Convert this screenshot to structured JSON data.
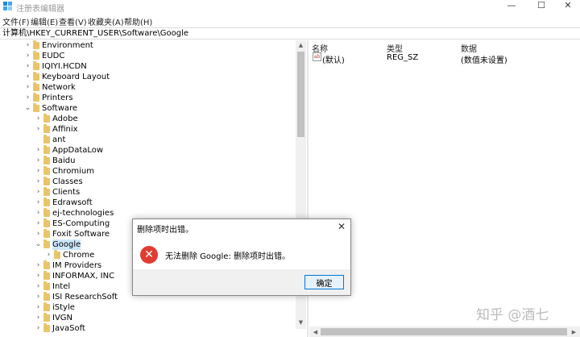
{
  "window": {
    "title": "注册表编辑器",
    "minimize": "—",
    "maximize": "☐",
    "close": "✕"
  },
  "menu": [
    "文件(F)",
    "编辑(E)",
    "查看(V)",
    "收藏夹(A)",
    "帮助(H)"
  ],
  "address": "计算机\\HKEY_CURRENT_USER\\Software\\Google",
  "tree": {
    "items": [
      {
        "label": "Environment",
        "level": 0,
        "expander": "collapsed"
      },
      {
        "label": "EUDC",
        "level": 0,
        "expander": "collapsed"
      },
      {
        "label": "IQIYI.HCDN",
        "level": 0,
        "expander": "collapsed"
      },
      {
        "label": "Keyboard Layout",
        "level": 0,
        "expander": "collapsed"
      },
      {
        "label": "Network",
        "level": 0,
        "expander": "collapsed"
      },
      {
        "label": "Printers",
        "level": 0,
        "expander": "collapsed"
      },
      {
        "label": "Software",
        "level": 0,
        "expander": "expanded"
      },
      {
        "label": "Adobe",
        "level": 1,
        "expander": "collapsed"
      },
      {
        "label": "Affinix",
        "level": 1,
        "expander": "collapsed"
      },
      {
        "label": "ant",
        "level": 1,
        "expander": "none"
      },
      {
        "label": "AppDataLow",
        "level": 1,
        "expander": "collapsed"
      },
      {
        "label": "Baidu",
        "level": 1,
        "expander": "collapsed"
      },
      {
        "label": "Chromium",
        "level": 1,
        "expander": "collapsed"
      },
      {
        "label": "Classes",
        "level": 1,
        "expander": "collapsed"
      },
      {
        "label": "Clients",
        "level": 1,
        "expander": "collapsed"
      },
      {
        "label": "Edrawsoft",
        "level": 1,
        "expander": "collapsed"
      },
      {
        "label": "ej-technologies",
        "level": 1,
        "expander": "collapsed"
      },
      {
        "label": "ES-Computing",
        "level": 1,
        "expander": "collapsed"
      },
      {
        "label": "Foxit Software",
        "level": 1,
        "expander": "collapsed"
      },
      {
        "label": "Google",
        "level": 1,
        "expander": "expanded",
        "selected": true
      },
      {
        "label": "Chrome",
        "level": 2,
        "expander": "collapsed"
      },
      {
        "label": "IM Providers",
        "level": 1,
        "expander": "collapsed"
      },
      {
        "label": "INFORMAX, INC",
        "level": 1,
        "expander": "collapsed"
      },
      {
        "label": "Intel",
        "level": 1,
        "expander": "collapsed"
      },
      {
        "label": "ISI ResearchSoft",
        "level": 1,
        "expander": "collapsed"
      },
      {
        "label": "iStyle",
        "level": 1,
        "expander": "collapsed"
      },
      {
        "label": "IVGN",
        "level": 1,
        "expander": "collapsed"
      },
      {
        "label": "JavaSoft",
        "level": 1,
        "expander": "collapsed"
      }
    ]
  },
  "list": {
    "columns": [
      "名称",
      "类型",
      "数据"
    ],
    "rows": [
      {
        "name": "(默认)",
        "type": "REG_SZ",
        "data": "(数值未设置)",
        "icon": "ab"
      }
    ]
  },
  "dialog": {
    "title": "删除项时出错。",
    "close": "✕",
    "icon": "error-icon",
    "message": "无法删除 Google: 删除项时出错。",
    "ok": "确定"
  },
  "watermark": "知乎 @酒七",
  "colors": {
    "selection": "#cce8ff",
    "folder": "#e9c46a",
    "error": "#e03c31",
    "button_border": "#0078d7"
  }
}
